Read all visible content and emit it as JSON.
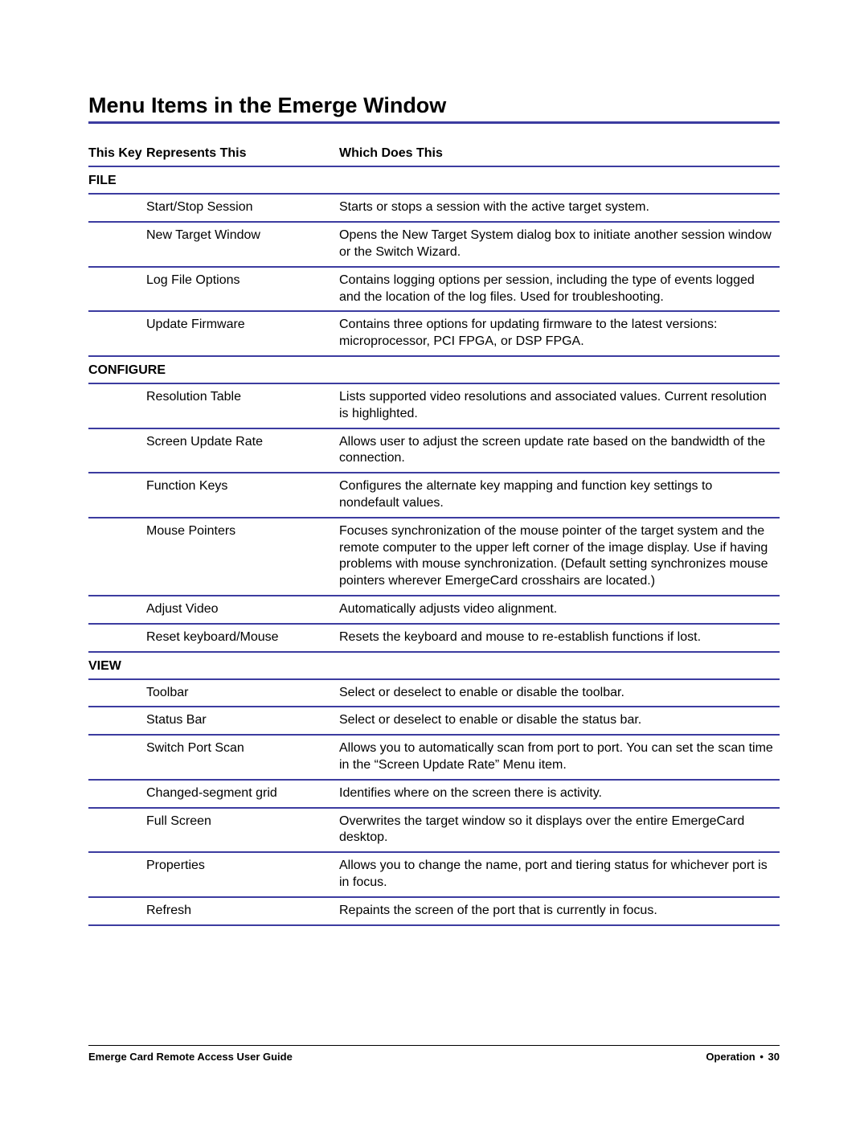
{
  "title": "Menu Items in the Emerge Window",
  "headers": {
    "key": "This Key",
    "rep": "Represents This",
    "does": "Which Does This"
  },
  "sections": [
    {
      "name": "FILE",
      "items": [
        {
          "key": "",
          "rep": "Start/Stop Session",
          "does": "Starts or stops a session with the active target system."
        },
        {
          "key": "",
          "rep": "New Target Window",
          "does": "Opens the New Target System dialog box to initiate another session window or the Switch Wizard."
        },
        {
          "key": "",
          "rep": "Log File Options",
          "does": "Contains logging options per session, including the type of events logged and the location of the log files. Used for troubleshooting."
        },
        {
          "key": "",
          "rep": "Update Firmware",
          "does": "Contains three options for updating firmware to the latest versions: microprocessor, PCI FPGA, or DSP FPGA."
        }
      ]
    },
    {
      "name": "CONFIGURE",
      "items": [
        {
          "key": "",
          "rep": "Resolution Table",
          "does": "Lists supported video resolutions and associated values. Current resolution is highlighted."
        },
        {
          "key": "",
          "rep": "Screen Update Rate",
          "does": "Allows user to adjust the screen update rate based on the bandwidth of the connection."
        },
        {
          "key": "",
          "rep": "Function Keys",
          "does": "Configures the alternate key mapping and function key settings to nondefault values."
        },
        {
          "key": "",
          "rep": "Mouse Pointers",
          "does": "Focuses synchronization of the mouse pointer of the target system and the remote computer to the upper left corner of the image display. Use if having problems with mouse synchronization.  (Default setting synchronizes mouse pointers wherever EmergeCard crosshairs are located.)"
        },
        {
          "key": "",
          "rep": "Adjust Video",
          "does": "Automatically adjusts video alignment."
        },
        {
          "key": "",
          "rep": "Reset keyboard/Mouse",
          "does": "Resets the keyboard and mouse to re-establish functions if lost."
        }
      ]
    },
    {
      "name": "VIEW",
      "items": [
        {
          "key": "",
          "rep": "Toolbar",
          "does": "Select or deselect to enable or disable the toolbar."
        },
        {
          "key": "",
          "rep": "Status Bar",
          "does": "Select or deselect to enable or disable the status bar."
        },
        {
          "key": "",
          "rep": "Switch Port Scan",
          "does": "Allows you to automatically scan from port to port. You can set the scan time in the “Screen Update Rate” Menu item."
        },
        {
          "key": "",
          "rep": "Changed-segment grid",
          "does": "Identifies where on the screen there is activity."
        },
        {
          "key": "",
          "rep": "Full Screen",
          "does": "Overwrites the target window so it displays over the entire EmergeCard desktop."
        },
        {
          "key": "",
          "rep": "Properties",
          "does": "Allows you to change the name, port and tiering status for whichever port is in focus."
        },
        {
          "key": "",
          "rep": "Refresh",
          "does": "Repaints the screen of the port that is currently in focus."
        }
      ]
    }
  ],
  "footer": {
    "left": "Emerge Card Remote Access User Guide",
    "right_label": "Operation",
    "right_sep": "•",
    "right_page": "30"
  }
}
